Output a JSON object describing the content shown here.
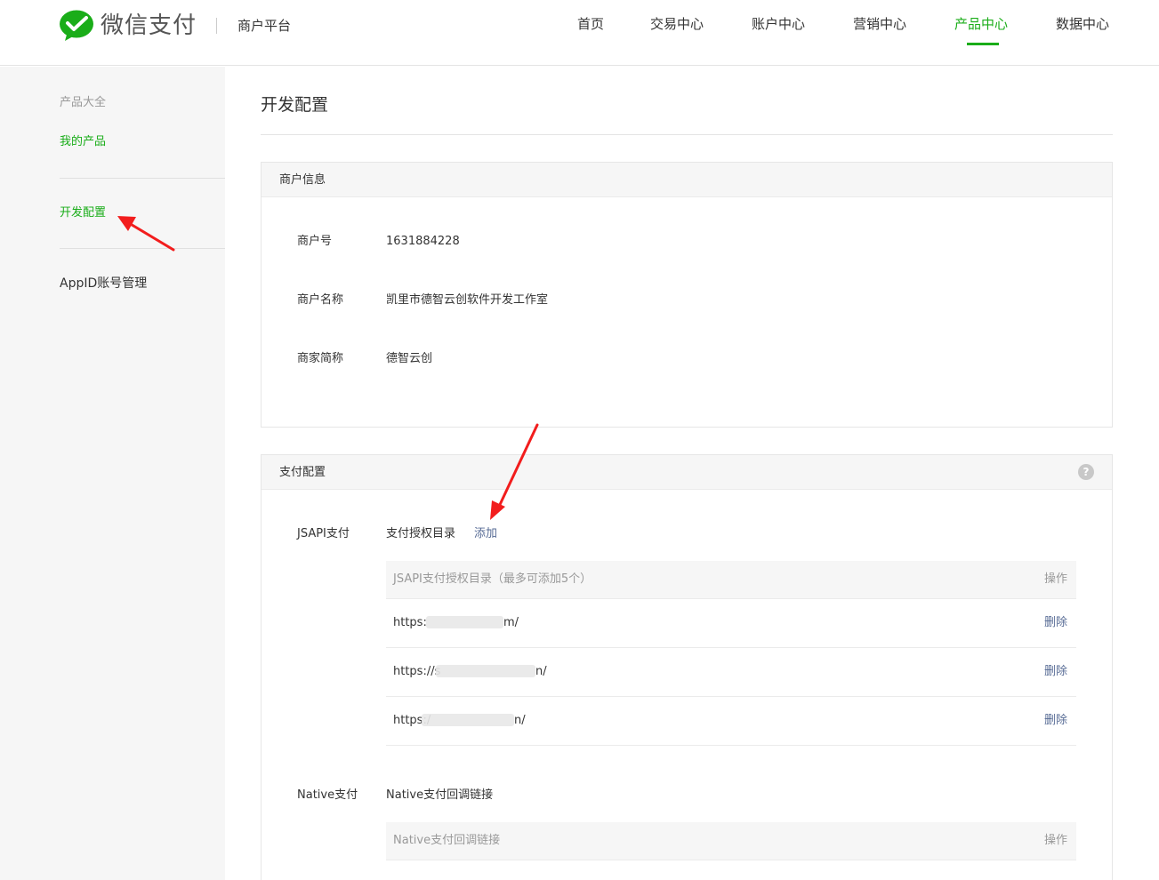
{
  "header": {
    "brand": "微信支付",
    "platform": "商户平台",
    "nav": [
      {
        "label": "首页",
        "active": false
      },
      {
        "label": "交易中心",
        "active": false
      },
      {
        "label": "账户中心",
        "active": false
      },
      {
        "label": "营销中心",
        "active": false
      },
      {
        "label": "产品中心",
        "active": true
      },
      {
        "label": "数据中心",
        "active": false
      }
    ]
  },
  "sidebar": {
    "items": [
      {
        "label": "产品大全"
      },
      {
        "label": "我的产品"
      },
      {
        "label": "开发配置"
      },
      {
        "label": "AppID账号管理"
      }
    ]
  },
  "page": {
    "title": "开发配置"
  },
  "merchant": {
    "section_title": "商户信息",
    "fields": [
      {
        "label": "商户号",
        "value": "1631884228"
      },
      {
        "label": "商户名称",
        "value": "凯里市德智云创软件开发工作室"
      },
      {
        "label": "商家简称",
        "value": "德智云创"
      }
    ]
  },
  "payment": {
    "section_title": "支付配置",
    "help_icon": "?",
    "jsapi": {
      "label": "JSAPI支付",
      "sub_label": "支付授权目录",
      "add_label": "添加",
      "table_header": "JSAPI支付授权目录（最多可添加5个）",
      "op_header": "操作",
      "rows": [
        {
          "prefix": "https:",
          "suffix": "m/",
          "action": "删除"
        },
        {
          "prefix": "https://s",
          "suffix": "n/",
          "action": "删除"
        },
        {
          "prefix": "https:/",
          "suffix": "n/",
          "action": "删除"
        }
      ]
    },
    "native": {
      "label": "Native支付",
      "sub_label": "Native支付回调链接",
      "table_header": "Native支付回调链接",
      "op_header": "操作"
    }
  },
  "colors": {
    "brand_green": "#1aad19",
    "link_blue": "#576b95",
    "annotation_red": "#f21d1d"
  }
}
